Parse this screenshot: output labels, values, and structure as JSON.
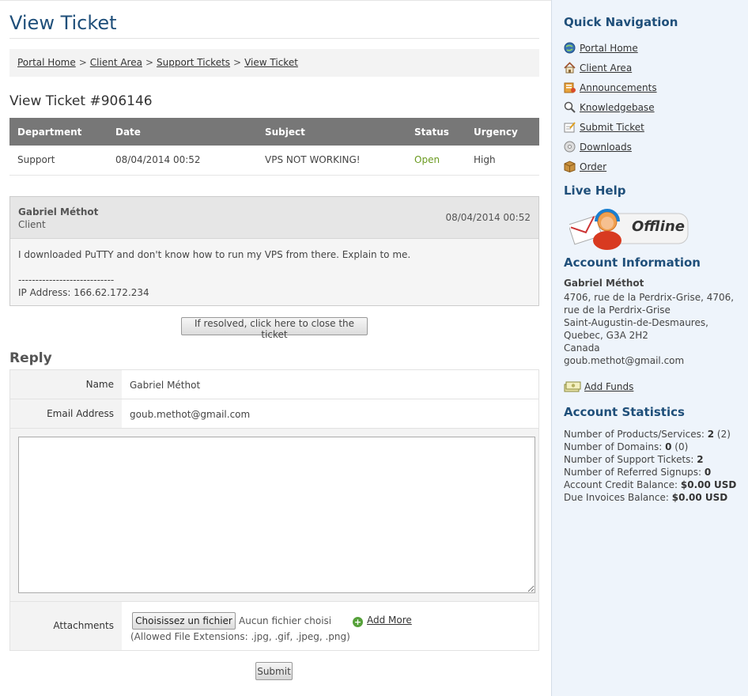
{
  "main": {
    "page_title": "View Ticket",
    "breadcrumb": [
      "Portal Home",
      "Client Area",
      "Support Tickets",
      "View Ticket"
    ],
    "breadcrumb_sep": ">",
    "ticket_heading": "View Ticket #906146",
    "table": {
      "headers": [
        "Department",
        "Date",
        "Subject",
        "Status",
        "Urgency"
      ],
      "row": {
        "department": "Support",
        "date": "08/04/2014 00:52",
        "subject": "VPS NOT WORKING!",
        "status": "Open",
        "urgency": "High"
      }
    },
    "message": {
      "author": "Gabriel Méthot",
      "role": "Client",
      "date": "08/04/2014 00:52",
      "body": "I downloaded PuTTY and don't know how to run my VPS from there. Explain to me.",
      "separator": "----------------------------",
      "ip": "IP Address: 166.62.172.234"
    },
    "close_button": "If resolved, click here to close the ticket",
    "reply": {
      "heading": "Reply",
      "name_label": "Name",
      "name_value": "Gabriel Méthot",
      "email_label": "Email Address",
      "email_value": "goub.methot@gmail.com",
      "message_value": "",
      "attachments_label": "Attachments",
      "file_button": "Choisissez un fichier",
      "file_status": "Aucun fichier choisi",
      "add_more": "Add More",
      "allowed": "(Allowed File Extensions: .jpg, .gif, .jpeg, .png)",
      "submit": "Submit"
    }
  },
  "sidebar": {
    "quick_nav_heading": "Quick Navigation",
    "nav_items": [
      {
        "label": "Portal Home",
        "icon": "globe-icon"
      },
      {
        "label": "Client Area",
        "icon": "house-icon"
      },
      {
        "label": "Announcements",
        "icon": "announcement-icon"
      },
      {
        "label": "Knowledgebase",
        "icon": "magnifier-icon"
      },
      {
        "label": "Submit Ticket",
        "icon": "ticket-icon"
      },
      {
        "label": "Downloads",
        "icon": "disc-icon"
      },
      {
        "label": "Order",
        "icon": "box-icon"
      }
    ],
    "live_help_heading": "Live Help",
    "live_help_status": "Offline",
    "account_info_heading": "Account Information",
    "account_name": "Gabriel Méthot",
    "account_lines": [
      "4706, rue de la Perdrix-Grise, 4706,",
      "rue de la Perdrix-Grise",
      "Saint-Augustin-de-Desmaures,",
      "Quebec, G3A 2H2",
      "Canada",
      "goub.methot@gmail.com"
    ],
    "add_funds": "Add Funds",
    "stats_heading": "Account Statistics",
    "stats": {
      "products_label": "Number of Products/Services:",
      "products_value": "2",
      "products_extra": "(2)",
      "domains_label": "Number of Domains:",
      "domains_value": "0",
      "domains_extra": "(0)",
      "tickets_label": "Number of Support Tickets:",
      "tickets_value": "2",
      "referred_label": "Number of Referred Signups:",
      "referred_value": "0",
      "credit_label": "Account Credit Balance:",
      "credit_value": "$0.00 USD",
      "due_label": "Due Invoices Balance:",
      "due_value": "$0.00 USD"
    }
  },
  "colors": {
    "heading_blue": "#1f4f7a",
    "table_header_bg": "#777777",
    "status_open": "#6a9a1f",
    "sidebar_bg": "#eef4fb"
  }
}
